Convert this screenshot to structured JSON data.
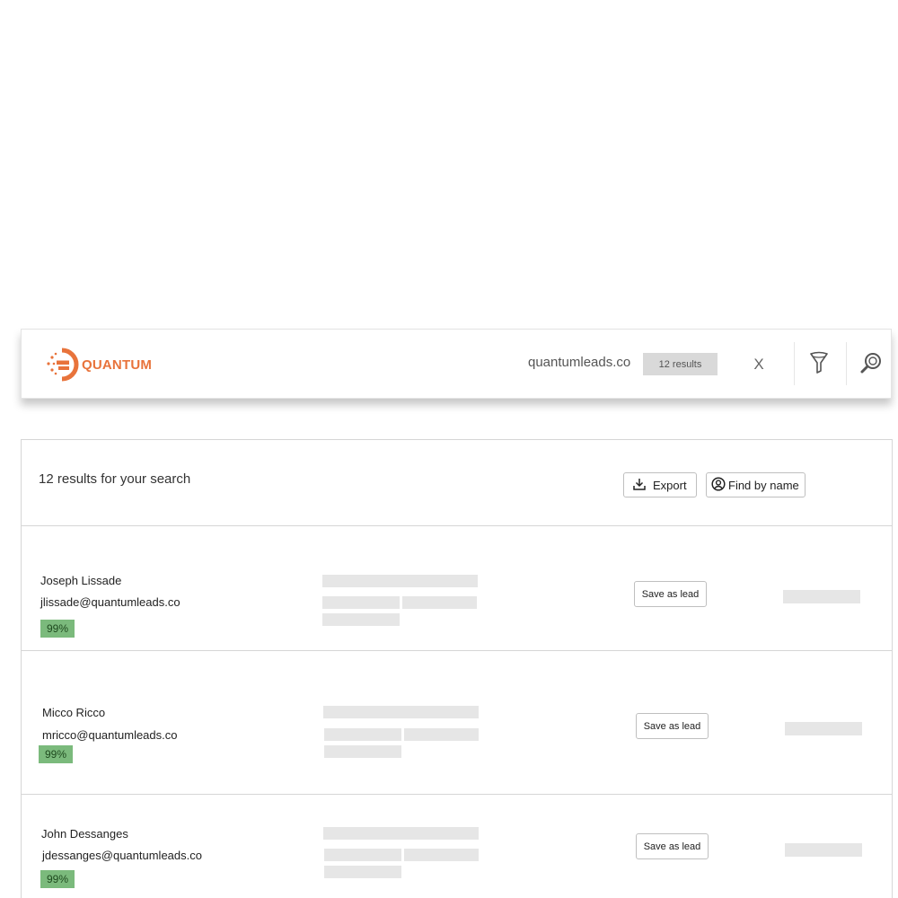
{
  "header": {
    "brand": "QUANTUM",
    "search_query": "quantumleads.co",
    "results_pill": "12 results",
    "clear_label": "X",
    "brand_color": "#e8733b"
  },
  "results": {
    "title": "12 results for your search",
    "export_label": "Export",
    "find_by_name_label": "Find by name"
  },
  "rows": [
    {
      "name": "Joseph Lissade",
      "email": "jlissade@quantumleads.co",
      "score": "99%",
      "action": "Save as lead"
    },
    {
      "name": "Micco Ricco",
      "email": "mricco@quantumleads.co",
      "score": "99%",
      "action": "Save as lead"
    },
    {
      "name": "John Dessanges",
      "email": "jdessanges@quantumleads.co",
      "score": "99%",
      "action": "Save as lead"
    }
  ],
  "colors": {
    "score_badge": "#7bba7c",
    "placeholder": "#e6e6e6",
    "results_pill": "#d9d9d9"
  },
  "icons": [
    "quantum-logo-icon",
    "filter-icon",
    "search-icon",
    "download-icon",
    "user-circle-icon"
  ]
}
